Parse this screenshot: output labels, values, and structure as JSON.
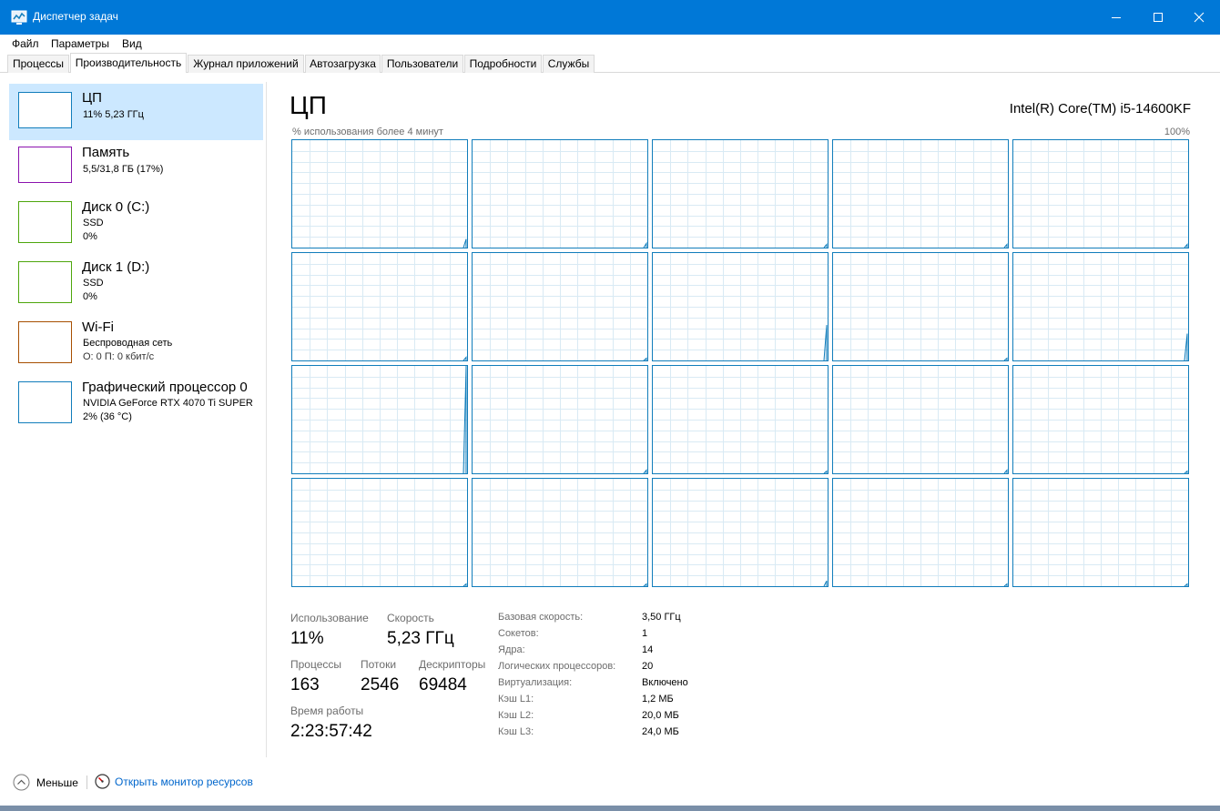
{
  "window": {
    "title": "Диспетчер задач",
    "accent_color": "#0078d7",
    "graph_color": "#117dbb"
  },
  "menu": [
    "Файл",
    "Параметры",
    "Вид"
  ],
  "tabs": [
    {
      "label": "Процессы",
      "active": false
    },
    {
      "label": "Производительность",
      "active": true
    },
    {
      "label": "Журнал приложений",
      "active": false
    },
    {
      "label": "Автозагрузка",
      "active": false
    },
    {
      "label": "Пользователи",
      "active": false
    },
    {
      "label": "Подробности",
      "active": false
    },
    {
      "label": "Службы",
      "active": false
    }
  ],
  "sidebar": {
    "items": [
      {
        "name": "ЦП",
        "line1": "11% 5,23 ГГц",
        "line2": "",
        "color": "#117dbb",
        "selected": true
      },
      {
        "name": "Память",
        "line1": "5,5/31,8 ГБ (17%)",
        "line2": "",
        "color": "#8b12ae",
        "selected": false
      },
      {
        "name": "Диск 0 (C:)",
        "line1": "SSD",
        "line2": "0%",
        "color": "#4da60c",
        "selected": false
      },
      {
        "name": "Диск 1 (D:)",
        "line1": "SSD",
        "line2": "0%",
        "color": "#4da60c",
        "selected": false
      },
      {
        "name": "Wi-Fi",
        "line1": "Беспроводная сеть",
        "line2": "О: 0 П: 0 кбит/с",
        "color": "#a74f01",
        "selected": false
      },
      {
        "name": "Графический процессор 0",
        "line1": "NVIDIA GeForce RTX 4070 Ti SUPER",
        "line2": "2% (36 °C)",
        "color": "#117dbb",
        "selected": false
      }
    ]
  },
  "main": {
    "title": "ЦП",
    "model": "Intel(R) Core(TM) i5-14600KF",
    "graph_caption_left": "% использования более 4 минут",
    "graph_caption_right": "100%",
    "core_spikes": [
      8,
      4,
      3,
      3,
      3,
      3,
      2,
      33,
      2,
      25,
      100,
      3,
      2,
      3,
      2,
      2,
      2,
      5,
      2,
      2
    ]
  },
  "stats": {
    "usage_label": "Использование",
    "usage_value": "11%",
    "speed_label": "Скорость",
    "speed_value": "5,23 ГГц",
    "processes_label": "Процессы",
    "processes_value": "163",
    "threads_label": "Потоки",
    "threads_value": "2546",
    "handles_label": "Дескрипторы",
    "handles_value": "69484",
    "uptime_label": "Время работы",
    "uptime_value": "2:23:57:42"
  },
  "specs": [
    {
      "label": "Базовая скорость:",
      "value": "3,50 ГГц"
    },
    {
      "label": "Сокетов:",
      "value": "1"
    },
    {
      "label": "Ядра:",
      "value": "14"
    },
    {
      "label": "Логических процессоров:",
      "value": "20"
    },
    {
      "label": "Виртуализация:",
      "value": "Включено"
    },
    {
      "label": "Кэш L1:",
      "value": "1,2 МБ"
    },
    {
      "label": "Кэш L2:",
      "value": "20,0 МБ"
    },
    {
      "label": "Кэш L3:",
      "value": "24,0 МБ"
    }
  ],
  "footer": {
    "less_label": "Меньше",
    "monitor_label": "Открыть монитор ресурсов"
  }
}
